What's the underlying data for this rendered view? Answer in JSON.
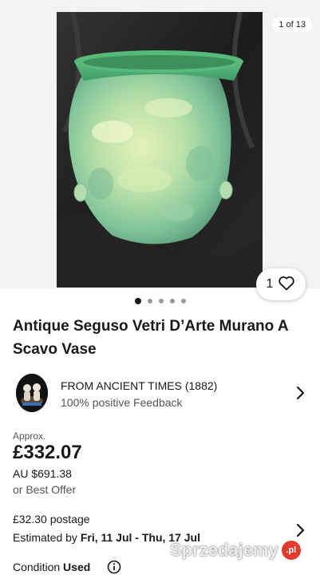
{
  "gallery": {
    "counter": "1 of 13",
    "like_count": "1",
    "dot_count": 5,
    "active_dot": 0
  },
  "listing": {
    "title": "Antique Seguso Vetri D’Arte Murano A Scavo Vase"
  },
  "seller": {
    "name": "FROM ANCIENT TIMES (1882)",
    "feedback": "100% positive Feedback"
  },
  "price": {
    "approx_label": "Approx.",
    "amount": "£332.07",
    "alt_amount": "AU $691.38",
    "best_offer": "or Best Offer"
  },
  "shipping": {
    "postage": "£32.30 postage",
    "estimate_prefix": "Estimated by ",
    "estimate_dates": "Fri, 11 Jul - Thu, 17 Jul"
  },
  "condition": {
    "label": "Condition",
    "value": "Used"
  },
  "watermark": {
    "text": "Sprzedajemy",
    "badge": ".pl"
  },
  "colors": {
    "text": "#191919",
    "muted": "#555555",
    "gallery_bg": "#f3f3f3",
    "vase_green": "#8fd1a0",
    "watermark_badge": "#e23a2b"
  },
  "icons": [
    "heart-icon",
    "chevron-right-icon",
    "info-icon"
  ]
}
